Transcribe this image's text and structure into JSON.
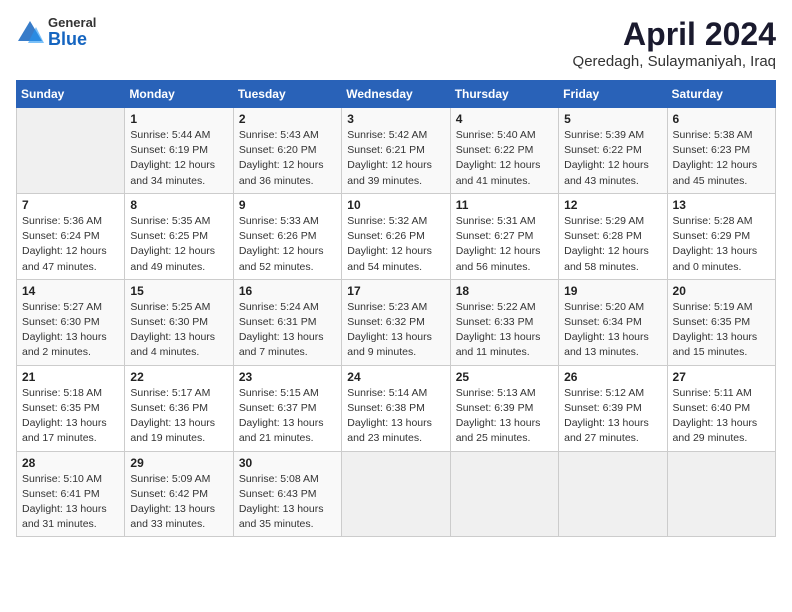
{
  "header": {
    "logo_general": "General",
    "logo_blue": "Blue",
    "title": "April 2024",
    "subtitle": "Qeredagh, Sulaymaniyah, Iraq"
  },
  "calendar": {
    "days_of_week": [
      "Sunday",
      "Monday",
      "Tuesday",
      "Wednesday",
      "Thursday",
      "Friday",
      "Saturday"
    ],
    "weeks": [
      [
        {
          "day": "",
          "info": ""
        },
        {
          "day": "1",
          "info": "Sunrise: 5:44 AM\nSunset: 6:19 PM\nDaylight: 12 hours\nand 34 minutes."
        },
        {
          "day": "2",
          "info": "Sunrise: 5:43 AM\nSunset: 6:20 PM\nDaylight: 12 hours\nand 36 minutes."
        },
        {
          "day": "3",
          "info": "Sunrise: 5:42 AM\nSunset: 6:21 PM\nDaylight: 12 hours\nand 39 minutes."
        },
        {
          "day": "4",
          "info": "Sunrise: 5:40 AM\nSunset: 6:22 PM\nDaylight: 12 hours\nand 41 minutes."
        },
        {
          "day": "5",
          "info": "Sunrise: 5:39 AM\nSunset: 6:22 PM\nDaylight: 12 hours\nand 43 minutes."
        },
        {
          "day": "6",
          "info": "Sunrise: 5:38 AM\nSunset: 6:23 PM\nDaylight: 12 hours\nand 45 minutes."
        }
      ],
      [
        {
          "day": "7",
          "info": "Sunrise: 5:36 AM\nSunset: 6:24 PM\nDaylight: 12 hours\nand 47 minutes."
        },
        {
          "day": "8",
          "info": "Sunrise: 5:35 AM\nSunset: 6:25 PM\nDaylight: 12 hours\nand 49 minutes."
        },
        {
          "day": "9",
          "info": "Sunrise: 5:33 AM\nSunset: 6:26 PM\nDaylight: 12 hours\nand 52 minutes."
        },
        {
          "day": "10",
          "info": "Sunrise: 5:32 AM\nSunset: 6:26 PM\nDaylight: 12 hours\nand 54 minutes."
        },
        {
          "day": "11",
          "info": "Sunrise: 5:31 AM\nSunset: 6:27 PM\nDaylight: 12 hours\nand 56 minutes."
        },
        {
          "day": "12",
          "info": "Sunrise: 5:29 AM\nSunset: 6:28 PM\nDaylight: 12 hours\nand 58 minutes."
        },
        {
          "day": "13",
          "info": "Sunrise: 5:28 AM\nSunset: 6:29 PM\nDaylight: 13 hours\nand 0 minutes."
        }
      ],
      [
        {
          "day": "14",
          "info": "Sunrise: 5:27 AM\nSunset: 6:30 PM\nDaylight: 13 hours\nand 2 minutes."
        },
        {
          "day": "15",
          "info": "Sunrise: 5:25 AM\nSunset: 6:30 PM\nDaylight: 13 hours\nand 4 minutes."
        },
        {
          "day": "16",
          "info": "Sunrise: 5:24 AM\nSunset: 6:31 PM\nDaylight: 13 hours\nand 7 minutes."
        },
        {
          "day": "17",
          "info": "Sunrise: 5:23 AM\nSunset: 6:32 PM\nDaylight: 13 hours\nand 9 minutes."
        },
        {
          "day": "18",
          "info": "Sunrise: 5:22 AM\nSunset: 6:33 PM\nDaylight: 13 hours\nand 11 minutes."
        },
        {
          "day": "19",
          "info": "Sunrise: 5:20 AM\nSunset: 6:34 PM\nDaylight: 13 hours\nand 13 minutes."
        },
        {
          "day": "20",
          "info": "Sunrise: 5:19 AM\nSunset: 6:35 PM\nDaylight: 13 hours\nand 15 minutes."
        }
      ],
      [
        {
          "day": "21",
          "info": "Sunrise: 5:18 AM\nSunset: 6:35 PM\nDaylight: 13 hours\nand 17 minutes."
        },
        {
          "day": "22",
          "info": "Sunrise: 5:17 AM\nSunset: 6:36 PM\nDaylight: 13 hours\nand 19 minutes."
        },
        {
          "day": "23",
          "info": "Sunrise: 5:15 AM\nSunset: 6:37 PM\nDaylight: 13 hours\nand 21 minutes."
        },
        {
          "day": "24",
          "info": "Sunrise: 5:14 AM\nSunset: 6:38 PM\nDaylight: 13 hours\nand 23 minutes."
        },
        {
          "day": "25",
          "info": "Sunrise: 5:13 AM\nSunset: 6:39 PM\nDaylight: 13 hours\nand 25 minutes."
        },
        {
          "day": "26",
          "info": "Sunrise: 5:12 AM\nSunset: 6:39 PM\nDaylight: 13 hours\nand 27 minutes."
        },
        {
          "day": "27",
          "info": "Sunrise: 5:11 AM\nSunset: 6:40 PM\nDaylight: 13 hours\nand 29 minutes."
        }
      ],
      [
        {
          "day": "28",
          "info": "Sunrise: 5:10 AM\nSunset: 6:41 PM\nDaylight: 13 hours\nand 31 minutes."
        },
        {
          "day": "29",
          "info": "Sunrise: 5:09 AM\nSunset: 6:42 PM\nDaylight: 13 hours\nand 33 minutes."
        },
        {
          "day": "30",
          "info": "Sunrise: 5:08 AM\nSunset: 6:43 PM\nDaylight: 13 hours\nand 35 minutes."
        },
        {
          "day": "",
          "info": ""
        },
        {
          "day": "",
          "info": ""
        },
        {
          "day": "",
          "info": ""
        },
        {
          "day": "",
          "info": ""
        }
      ]
    ]
  }
}
